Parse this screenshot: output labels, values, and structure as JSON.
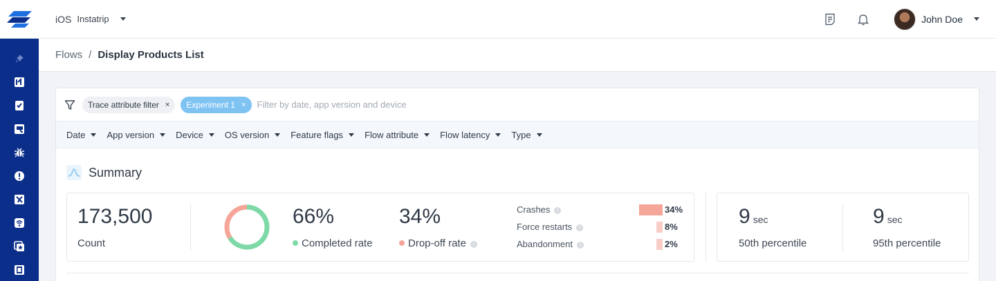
{
  "topbar": {
    "platform": "iOS",
    "app_name": "Instatrip",
    "user_name": "John Doe"
  },
  "breadcrumb": {
    "parent": "Flows",
    "separator": "/",
    "current": "Display Products List"
  },
  "filters": {
    "chips": [
      {
        "label": "Trace attribute filter",
        "remove": "×"
      },
      {
        "label": "Experiment 1",
        "remove": "×"
      }
    ],
    "placeholder": "Filter by date, app version and device",
    "dropdowns": [
      "Date",
      "App version",
      "Device",
      "OS version",
      "Feature flags",
      "Flow attribute",
      "Flow latency",
      "Type"
    ]
  },
  "summary": {
    "title": "Summary",
    "count": {
      "value": "173,500",
      "label": "Count"
    },
    "completed": {
      "value": "66%",
      "label": "Completed rate",
      "fraction": 0.66
    },
    "dropoff": {
      "value": "34%",
      "label": "Drop-off rate",
      "fraction": 0.34
    },
    "breakdown": [
      {
        "label": "Crashes",
        "value": "34%",
        "fraction": 0.34
      },
      {
        "label": "Force restarts",
        "value": "8%",
        "fraction": 0.08
      },
      {
        "label": "Abandonment",
        "value": "2%",
        "fraction": 0.02
      }
    ],
    "p50": {
      "value": "9",
      "unit": "sec",
      "label": "50th percentile"
    },
    "p95": {
      "value": "9",
      "unit": "sec",
      "label": "95th percentile"
    }
  },
  "colors": {
    "sidebar": "#0b2e8a",
    "completed": "#7ed9a7",
    "dropoff": "#f6a699",
    "chip_blue": "#7fc3f3"
  },
  "icons": {
    "sidebar": [
      "pin-icon",
      "flows-icon",
      "document-icon",
      "screen-icon",
      "bug-icon",
      "alert-icon",
      "crash-icon",
      "network-icon",
      "star-window-icon",
      "survey-icon"
    ],
    "topbar": [
      "notes-icon",
      "bell-icon"
    ]
  }
}
